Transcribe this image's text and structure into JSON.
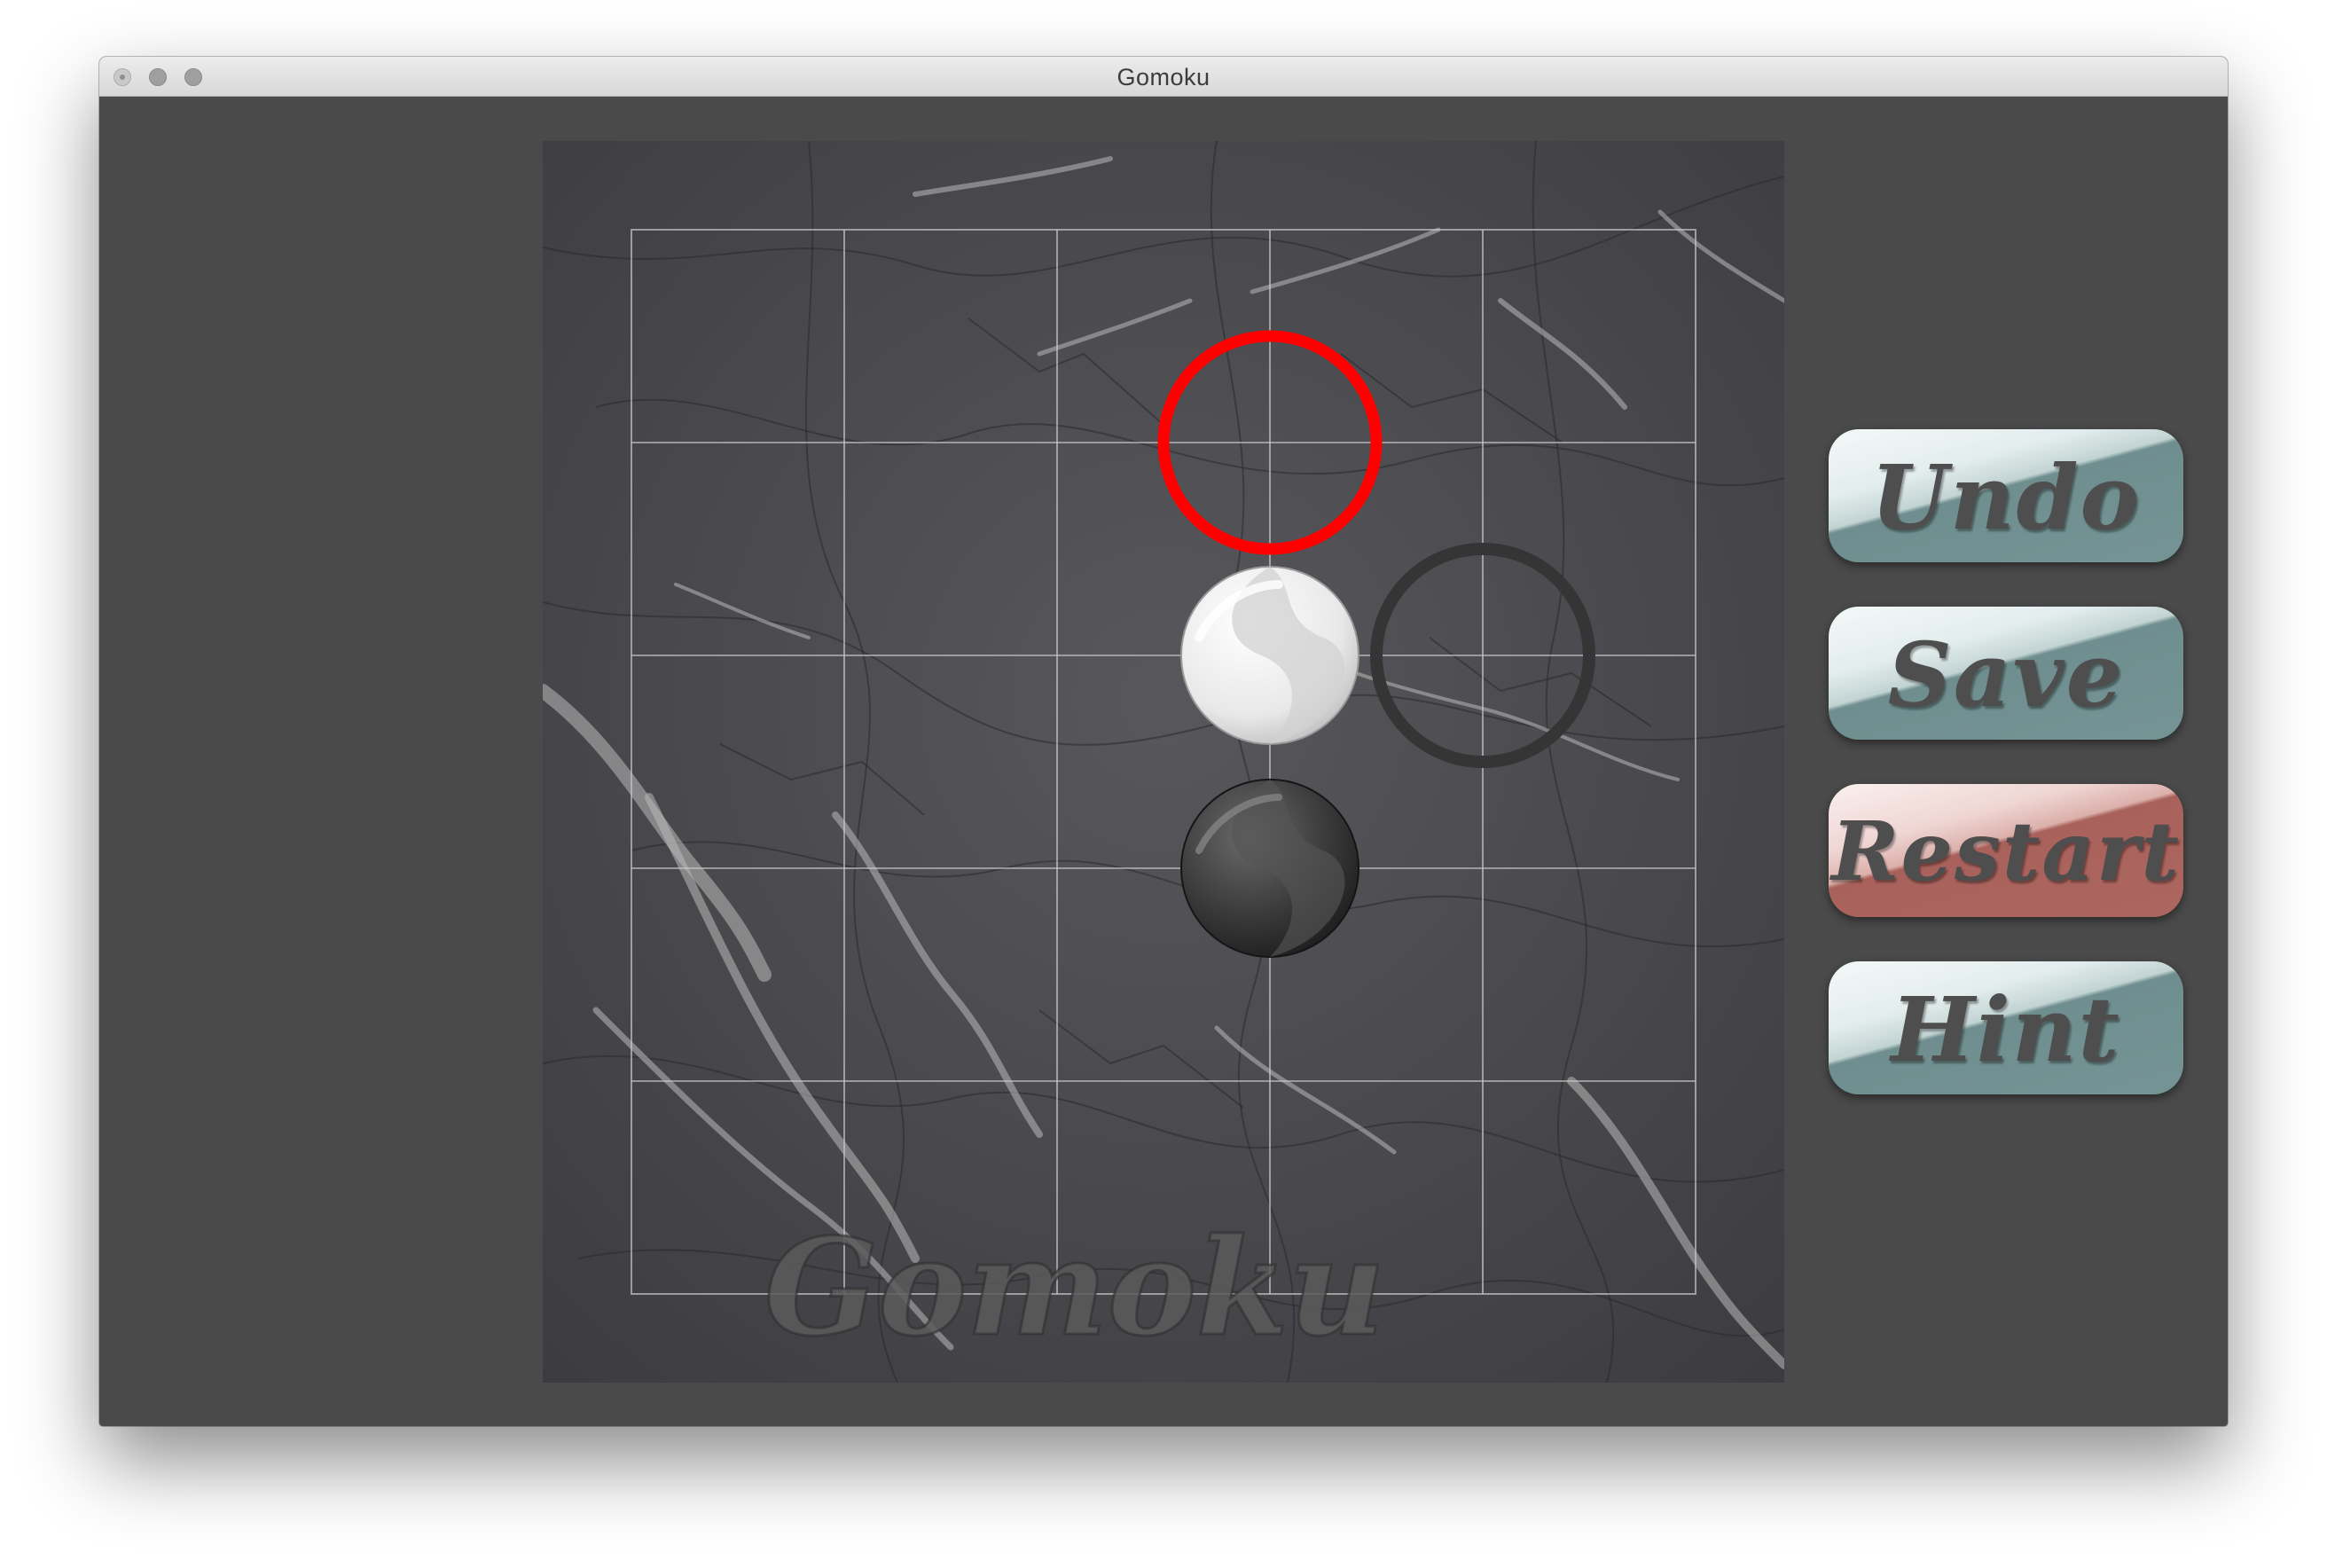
{
  "window": {
    "title": "Gomoku"
  },
  "board": {
    "watermark": "Gomoku",
    "grid_cells": 5,
    "stones": [
      {
        "color": "white",
        "col": 3,
        "row": 2
      },
      {
        "color": "black",
        "col": 3,
        "row": 3
      }
    ],
    "markers": [
      {
        "type": "last-move-ring",
        "color": "#ff0000",
        "col": 3,
        "row": 1
      },
      {
        "type": "hint-ring",
        "color": "#353535",
        "col": 4,
        "row": 2
      }
    ]
  },
  "controls": {
    "undo_label": "Undo",
    "save_label": "Save",
    "restart_label": "Restart",
    "hint_label": "Hint"
  },
  "colors": {
    "window_bg": "#4a4a4a",
    "button_teal": "#759495",
    "button_red": "#ac6660",
    "marker_red": "#ff0000"
  }
}
